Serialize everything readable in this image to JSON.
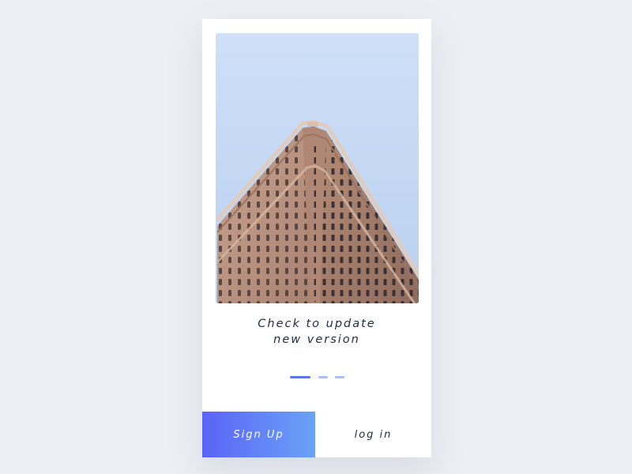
{
  "onboarding": {
    "headline_line1": "Check to update",
    "headline_line2": "new version",
    "pager": {
      "total": 3,
      "active_index": 0
    }
  },
  "actions": {
    "signup_label": "Sign Up",
    "login_label": "log in"
  },
  "colors": {
    "background": "#eceff3",
    "card": "#ffffff",
    "text": "#1d2a44",
    "accent": "#5a76ea",
    "accent_light": "#aabef3",
    "signup_gradient_start": "#5b63f7",
    "signup_gradient_end": "#6aa3f7",
    "sky": "#cfe0f8"
  },
  "hero_image": {
    "subject": "flatiron-building"
  }
}
